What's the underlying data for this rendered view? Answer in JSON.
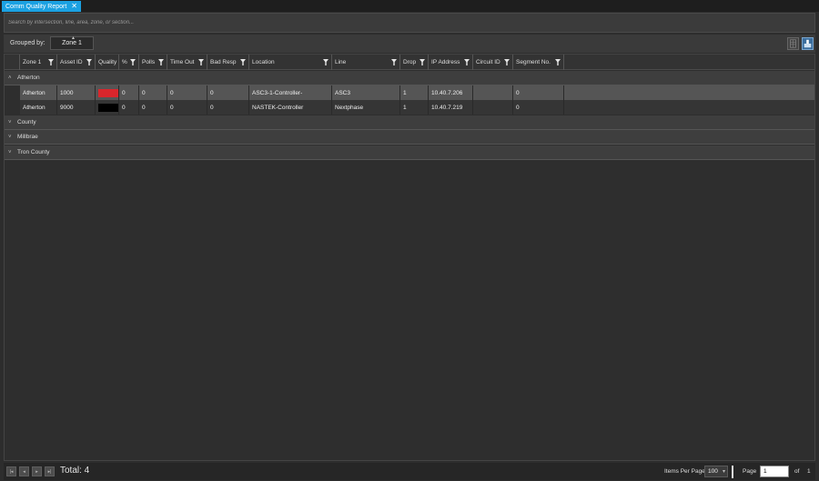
{
  "tab": {
    "title": "Comm Quality Report",
    "close_glyph": "✕"
  },
  "search": {
    "placeholder": "Search by intersection, line, area, zone, or section..."
  },
  "grouping": {
    "label": "Grouped by:",
    "chip": "Zone 1"
  },
  "columns": [
    "Zone 1",
    "Asset ID",
    "Quality",
    "%",
    "Polls",
    "Time Out",
    "Bad Resp",
    "Location",
    "Line",
    "Drop",
    "IP Address",
    "Circuit ID",
    "Segment No."
  ],
  "groups": [
    {
      "name": "Atherton",
      "expanded": true
    },
    {
      "name": "County",
      "expanded": false
    },
    {
      "name": "Millbrae",
      "expanded": false
    },
    {
      "name": "Tron County",
      "expanded": false
    }
  ],
  "rows": [
    {
      "zone": "Atherton",
      "asset_id": "1000",
      "quality_color": "#d9262c",
      "percent": "0",
      "polls": "0",
      "time_out": "0",
      "bad_resp": "0",
      "location": "ASC3-1-Controller-",
      "line": "ASC3",
      "drop": "1",
      "ip": "10.40.7.206",
      "circuit_id": "",
      "segment_no": "0"
    },
    {
      "zone": "Atherton",
      "asset_id": "9000",
      "quality_color": "#000000",
      "percent": "0",
      "polls": "0",
      "time_out": "0",
      "bad_resp": "0",
      "location": "NASTEK-Controller",
      "line": "Nextphase",
      "drop": "1",
      "ip": "10.40.7.219",
      "circuit_id": "",
      "segment_no": "0"
    }
  ],
  "footer": {
    "total": "Total: 4",
    "items_per_page_label": "Items Per Page",
    "items_per_page": "100",
    "page_label": "Page",
    "page_value": "1",
    "of_label": "of",
    "page_count": "1"
  },
  "icons": {
    "filter": "filter-icon",
    "chevron_up": "chevron-up-icon",
    "chevron_down": "chevron-down-icon",
    "first": "first-page-icon",
    "prev": "prev-page-icon",
    "next": "next-page-icon",
    "last": "last-page-icon"
  },
  "colors": {
    "accent": "#1ba1e2",
    "quality_bad": "#d9262c",
    "quality_none": "#000000"
  }
}
